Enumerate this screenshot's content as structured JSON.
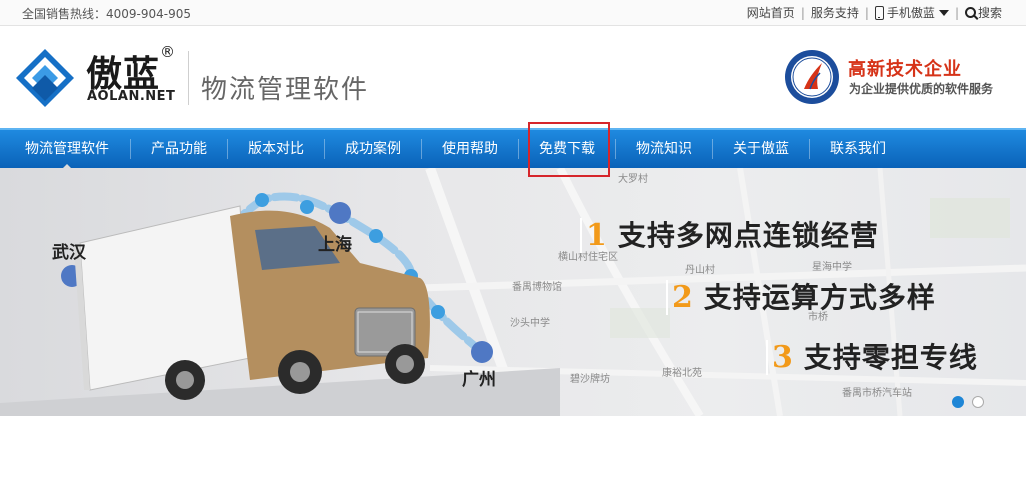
{
  "topbar": {
    "hotline": "全国销售热线：4009-904-905",
    "links": {
      "home": "网站首页",
      "support": "服务支持",
      "mobile": "手机傲蓝",
      "search": "搜索"
    },
    "separator": "|"
  },
  "header": {
    "logo_cn": "傲蓝",
    "logo_reg": "®",
    "logo_en": "AOLAN.NET",
    "tagline": "物流管理软件",
    "badge_title": "高新技术企业",
    "badge_sub": "为企业提供优质的软件服务"
  },
  "nav": {
    "items": [
      {
        "label": "物流管理软件"
      },
      {
        "label": "产品功能"
      },
      {
        "label": "版本对比"
      },
      {
        "label": "成功案例"
      },
      {
        "label": "使用帮助"
      },
      {
        "label": "免费下载"
      },
      {
        "label": "物流知识"
      },
      {
        "label": "关于傲蓝"
      },
      {
        "label": "联系我们"
      }
    ]
  },
  "banner": {
    "cities": {
      "wuhan": "武汉",
      "shanghai": "上海",
      "guangzhou": "广州"
    },
    "features": [
      {
        "num": "1",
        "text": "支持多网点连锁经营"
      },
      {
        "num": "2",
        "text": "支持运算方式多样"
      },
      {
        "num": "3",
        "text": "支持零担专线"
      }
    ],
    "map_labels": {
      "dalucun": "大罗村",
      "hengshan": "横山村住宅区",
      "danshan": "丹山村",
      "xinghai": "星海中学",
      "fanyu_museum": "番禺博物馆",
      "shatou": "沙头中学",
      "shiqiao": "市桥",
      "biguifang": "碧沙牌坊",
      "kangyu": "康裕北苑",
      "bus_station": "番禺市桥汽车站"
    },
    "active_slide": 1,
    "slide_count": 2
  },
  "colors": {
    "nav_top": "#1f8ae0",
    "nav_bottom": "#0a62b8",
    "badge_red": "#d63318",
    "feature_orange": "#f29a1a",
    "highlight": "#d6252b"
  }
}
